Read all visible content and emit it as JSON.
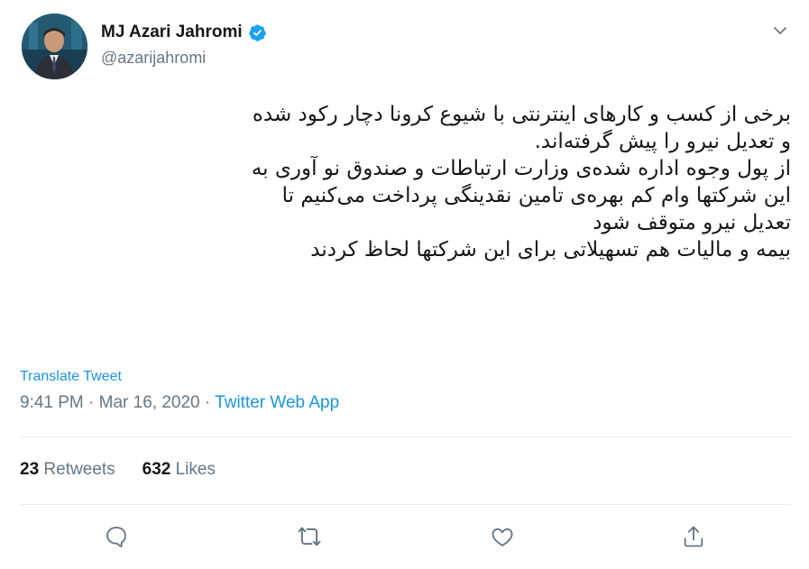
{
  "user": {
    "display_name": "MJ Azari Jahromi",
    "handle": "@azarijahromi",
    "verified": true
  },
  "tweet": {
    "lines": [
      "برخی از کسب و کارهای اینترنتی با شیوع کرونا دچار رکود شده",
      "و تعدیل نیرو را پیش گرفته‌اند.",
      "از پول وجوه اداره شده‌ی وزارت ارتباطات و صندوق نو آوری به",
      "این شرکتها وام کم بهره‌ی تامین نقدینگی پرداخت می‌کنیم تا",
      "تعدیل نیرو متوقف شود",
      "بیمه و مالیات هم تسهیلاتی برای این شرکتها لحاظ کردند"
    ],
    "translate_label": "Translate Tweet",
    "time": "9:41 PM",
    "separator": "·",
    "date": "Mar 16, 2020",
    "source": "Twitter Web App"
  },
  "stats": {
    "retweets_count": "23",
    "retweets_label": "Retweets",
    "likes_count": "632",
    "likes_label": "Likes"
  },
  "actions": {
    "icons": [
      "reply-icon",
      "retweet-icon",
      "like-icon",
      "share-icon"
    ]
  },
  "colors": {
    "accent": "#1b95e0",
    "secondary_text": "#657786",
    "primary_text": "#14171a",
    "divider": "#e6ecf0",
    "verified": "#1da1f2"
  }
}
